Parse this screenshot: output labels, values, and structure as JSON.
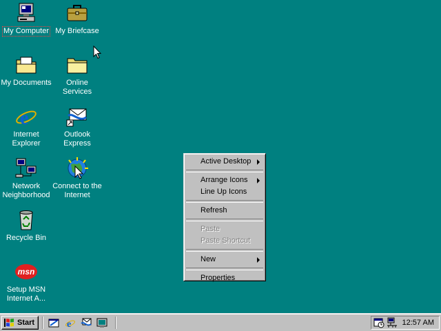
{
  "desktop": {
    "icons": [
      {
        "label": "My Computer"
      },
      {
        "label": "My Briefcase"
      },
      {
        "label": "My Documents"
      },
      {
        "label": "Online\nServices"
      },
      {
        "label": "Internet\nExplorer"
      },
      {
        "label": "Outlook\nExpress"
      },
      {
        "label": "Network\nNeighborhood"
      },
      {
        "label": "Connect to the\nInternet"
      },
      {
        "label": "Recycle Bin"
      },
      {
        "label": "Setup MSN\nInternet A..."
      }
    ],
    "msn_logo_text": "msn"
  },
  "context_menu": {
    "items": [
      {
        "label": "Active Desktop",
        "submenu": true,
        "enabled": true
      },
      {
        "label": "Arrange Icons",
        "submenu": true,
        "enabled": true
      },
      {
        "label": "Line Up Icons",
        "submenu": false,
        "enabled": true
      },
      {
        "label": "Refresh",
        "submenu": false,
        "enabled": true
      },
      {
        "label": "Paste",
        "submenu": false,
        "enabled": false
      },
      {
        "label": "Paste Shortcut",
        "submenu": false,
        "enabled": false
      },
      {
        "label": "New",
        "submenu": true,
        "enabled": true
      },
      {
        "label": "Properties",
        "submenu": false,
        "enabled": true
      }
    ]
  },
  "taskbar": {
    "start_label": "Start",
    "clock": "12:57 AM"
  },
  "colors": {
    "desktop": "#008080",
    "face": "#c0c0c0",
    "disabled_text": "#808080"
  }
}
